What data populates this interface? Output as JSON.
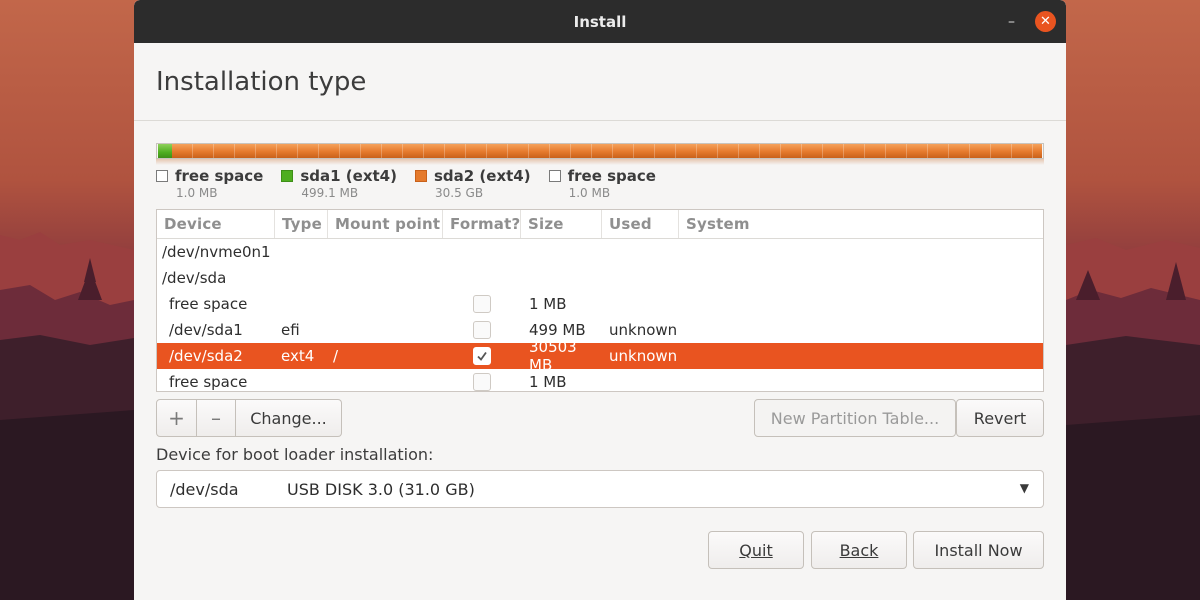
{
  "window": {
    "title": "Install"
  },
  "page": {
    "heading": "Installation type"
  },
  "legend": [
    {
      "name": "free space",
      "size": "1.0 MB",
      "color": "#f6f5f4"
    },
    {
      "name": "sda1 (ext4)",
      "size": "499.1 MB",
      "color": "#4fae20"
    },
    {
      "name": "sda2 (ext4)",
      "size": "30.5 GB",
      "color": "#e57a2c"
    },
    {
      "name": "free space",
      "size": "1.0 MB",
      "color": "#f6f5f4"
    }
  ],
  "table": {
    "headers": [
      "Device",
      "Type",
      "Mount point",
      "Format?",
      "Size",
      "Used",
      "System"
    ],
    "rows": [
      {
        "device": "/dev/nvme0n1",
        "type": "",
        "mount": "",
        "format": null,
        "size": "",
        "used": "",
        "system": ""
      },
      {
        "device": "/dev/sda",
        "type": "",
        "mount": "",
        "format": null,
        "size": "",
        "used": "",
        "system": ""
      },
      {
        "device": "free space",
        "type": "",
        "mount": "",
        "format": false,
        "size": "1 MB",
        "used": "",
        "system": ""
      },
      {
        "device": "/dev/sda1",
        "type": "efi",
        "mount": "",
        "format": false,
        "size": "499 MB",
        "used": "unknown",
        "system": ""
      },
      {
        "device": "/dev/sda2",
        "type": "ext4",
        "mount": "/",
        "format": true,
        "size": "30503 MB",
        "used": "unknown",
        "system": ""
      },
      {
        "device": "free space",
        "type": "",
        "mount": "",
        "format": false,
        "size": "1 MB",
        "used": "",
        "system": ""
      }
    ]
  },
  "partition_buttons": {
    "add": "+",
    "remove": "–",
    "change": "Change...",
    "new_table": "New Partition Table...",
    "revert": "Revert"
  },
  "bootloader": {
    "label": "Device for boot loader installation:",
    "device": "/dev/sda",
    "description": "USB DISK 3.0 (31.0 GB)"
  },
  "footer": {
    "quit": "Quit",
    "back": "Back",
    "install": "Install Now"
  },
  "colors": {
    "accent": "#e95420",
    "efi": "#4fae20",
    "ext4": "#e57a2c"
  }
}
